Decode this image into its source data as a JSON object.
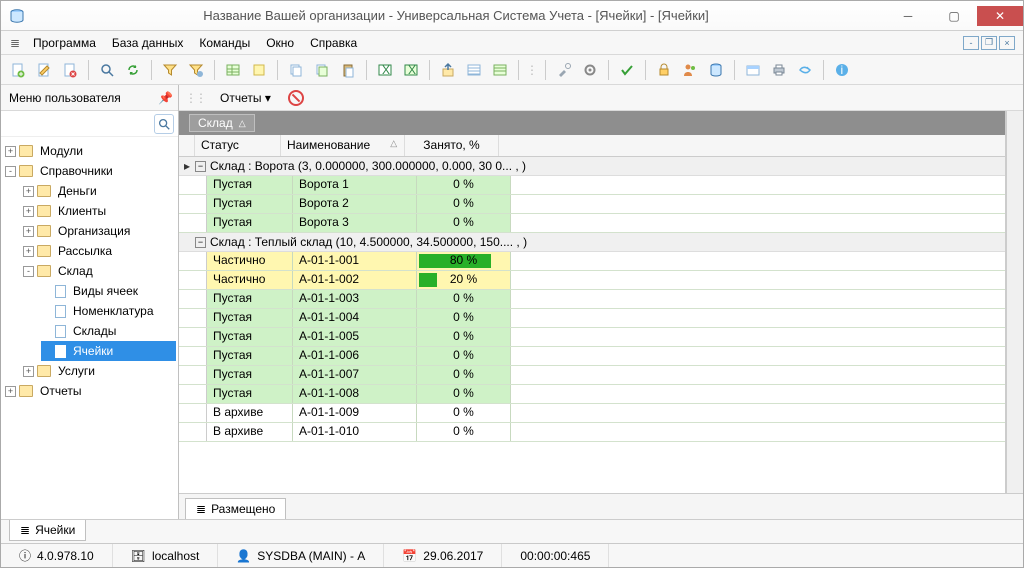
{
  "window": {
    "title": "Название Вашей организации - Универсальная Система Учета - [Ячейки] - [Ячейки]"
  },
  "menu": {
    "items": [
      "Программа",
      "База данных",
      "Команды",
      "Окно",
      "Справка"
    ]
  },
  "userMenu": {
    "title": "Меню пользователя"
  },
  "tree": {
    "nodes": [
      {
        "label": "Модули",
        "type": "folder",
        "exp": "+"
      },
      {
        "label": "Справочники",
        "type": "folder",
        "exp": "-",
        "children": [
          {
            "label": "Деньги",
            "type": "folder",
            "exp": "+"
          },
          {
            "label": "Клиенты",
            "type": "folder",
            "exp": "+"
          },
          {
            "label": "Организация",
            "type": "folder",
            "exp": "+"
          },
          {
            "label": "Рассылка",
            "type": "folder",
            "exp": "+"
          },
          {
            "label": "Склад",
            "type": "folder",
            "exp": "-",
            "children": [
              {
                "label": "Виды ячеек",
                "type": "doc"
              },
              {
                "label": "Номенклатура",
                "type": "doc"
              },
              {
                "label": "Склады",
                "type": "doc"
              },
              {
                "label": "Ячейки",
                "type": "doc",
                "selected": true
              }
            ]
          },
          {
            "label": "Услуги",
            "type": "folder",
            "exp": "+"
          }
        ]
      },
      {
        "label": "Отчеты",
        "type": "folder",
        "exp": "+"
      }
    ]
  },
  "reports": {
    "button": "Отчеты ▾"
  },
  "grid": {
    "groupBy": "Склад",
    "columns": {
      "status": "Статус",
      "name": "Наименование",
      "occ": "Занято, %"
    },
    "groups": [
      {
        "title": "Склад : Ворота (3, 0.000000, 300.000000, 0.000, 30 0... , )",
        "marker": true,
        "rows": [
          {
            "status": "Пустая",
            "name": "Ворота 1",
            "occ": 0,
            "style": "green"
          },
          {
            "status": "Пустая",
            "name": "Ворота 2",
            "occ": 0,
            "style": "green"
          },
          {
            "status": "Пустая",
            "name": "Ворота 3",
            "occ": 0,
            "style": "green"
          }
        ]
      },
      {
        "title": "Склад : Теплый склад (10, 4.500000, 34.500000, 150.... , )",
        "rows": [
          {
            "status": "Частично",
            "name": "A-01-1-001",
            "occ": 80,
            "style": "yellow",
            "bar": true
          },
          {
            "status": "Частично",
            "name": "A-01-1-002",
            "occ": 20,
            "style": "yellow",
            "bar": true
          },
          {
            "status": "Пустая",
            "name": "A-01-1-003",
            "occ": 0,
            "style": "green"
          },
          {
            "status": "Пустая",
            "name": "A-01-1-004",
            "occ": 0,
            "style": "green"
          },
          {
            "status": "Пустая",
            "name": "A-01-1-005",
            "occ": 0,
            "style": "green"
          },
          {
            "status": "Пустая",
            "name": "A-01-1-006",
            "occ": 0,
            "style": "green"
          },
          {
            "status": "Пустая",
            "name": "A-01-1-007",
            "occ": 0,
            "style": "green"
          },
          {
            "status": "Пустая",
            "name": "A-01-1-008",
            "occ": 0,
            "style": "green"
          },
          {
            "status": "В архиве",
            "name": "A-01-1-009",
            "occ": 0,
            "style": "plain"
          },
          {
            "status": "В архиве",
            "name": "A-01-1-010",
            "occ": 0,
            "style": "plain"
          }
        ]
      }
    ]
  },
  "bottomTab": "Размещено",
  "docTab": "Ячейки",
  "status": {
    "version": "4.0.978.10",
    "host": "localhost",
    "user": "SYSDBA (MAIN) - А",
    "date": "29.06.2017",
    "elapsed": "00:00:00:465"
  }
}
